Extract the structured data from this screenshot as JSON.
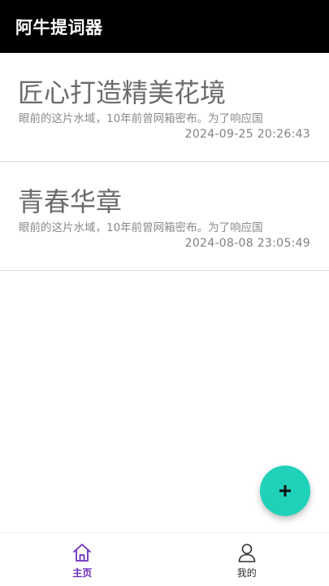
{
  "app": {
    "title": "阿牛提词器"
  },
  "scripts": [
    {
      "title": "匠心打造精美花境",
      "excerpt": "眼前的这片水域，10年前曾网箱密布。为了响应国",
      "time": "2024-09-25 20:26:43"
    },
    {
      "title": "青春华章",
      "excerpt": "眼前的这片水域，10年前曾网箱密布。为了响应国",
      "time": "2024-08-08 23:05:49"
    }
  ],
  "fab": {
    "icon": "plus-icon"
  },
  "nav": {
    "items": [
      {
        "label": "主页",
        "icon": "home-icon",
        "active": true
      },
      {
        "label": "我的",
        "icon": "user-icon",
        "active": false
      }
    ]
  },
  "colors": {
    "topbar": "#000000",
    "fab": "#1fd1b9",
    "nav_active": "#6d2fc0"
  }
}
